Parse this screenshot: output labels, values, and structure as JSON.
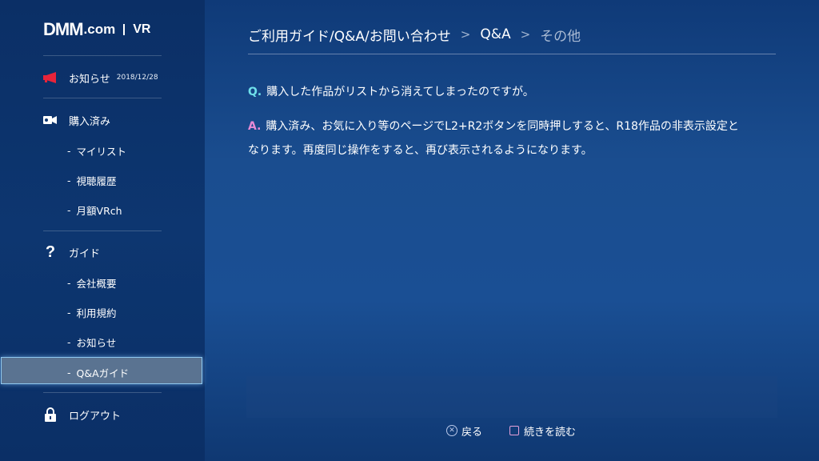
{
  "logo": {
    "dmm": "DMM",
    "com": ".com",
    "vr": "VR"
  },
  "sidebar": {
    "news": {
      "label": "お知らせ",
      "date": "2018/12/28"
    },
    "purchased": {
      "label": "購入済み"
    },
    "purchased_items": [
      "マイリスト",
      "視聴履歴",
      "月額VRch"
    ],
    "guide": {
      "label": "ガイド"
    },
    "guide_items": [
      "会社概要",
      "利用規約",
      "お知らせ",
      "Q&Aガイド"
    ],
    "logout": {
      "label": "ログアウト"
    },
    "sub_prefix": "-",
    "selected_item": "Q&Aガイド"
  },
  "breadcrumb": {
    "items": [
      "ご利用ガイド/Q&A/お問い合わせ",
      "Q&A",
      "その他"
    ],
    "separator": ">"
  },
  "qa": {
    "q_mark": "Q.",
    "question": "購入した作品がリストから消えてしまったのですが。",
    "a_mark": "A.",
    "answer_line1": "購入済み、お気に入り等のページでL2+R2ボタンを同時押しすると、R18作品の非表示設定と",
    "answer_line2": "なります。再度同じ操作をすると、再び表示されるようになります。"
  },
  "hints": {
    "back": "戻る",
    "read_more": "続きを読む"
  },
  "colors": {
    "q_accent": "#6fe0ea",
    "a_accent": "#e68ad6",
    "selected_bg": "#5a7391",
    "selected_border": "#8fc8f0"
  },
  "icons": {
    "news": "megaphone-icon",
    "purchased": "video-camera-icon",
    "guide": "question-mark-icon",
    "logout": "lock-icon",
    "back": "cross-button-icon",
    "read_more": "square-button-icon"
  }
}
